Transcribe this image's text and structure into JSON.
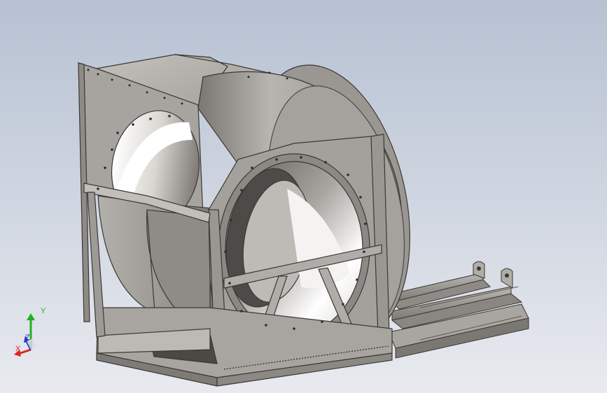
{
  "scene": {
    "subject": "centrifugal-fan-on-base-frame",
    "colors": {
      "background_top": "#b9c4d4",
      "background_bottom": "#e6e8ed",
      "metal_light": "#bdbab5",
      "metal_mid": "#9d9a95",
      "metal_dark": "#6f6c68",
      "outline": "#3a3835",
      "bore_light": "#ffffff",
      "bore_dark": "#5e5b57"
    }
  },
  "triad": {
    "x_label": "X",
    "y_label": "Y",
    "z_label": "Z",
    "colors": {
      "x": "#e02020",
      "y": "#20b020",
      "z": "#2030d0"
    }
  }
}
